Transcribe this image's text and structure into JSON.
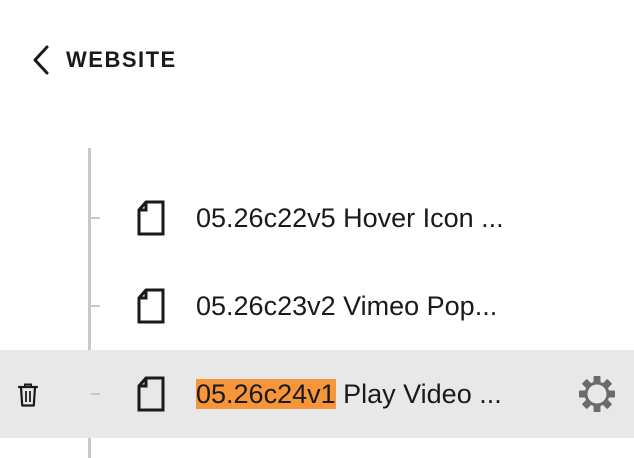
{
  "header": {
    "back_label": "WEBSITE"
  },
  "pages": [
    {
      "label": "05.26c22v5 Hover Icon ..."
    },
    {
      "label": "05.26c23v2 Vimeo Pop..."
    },
    {
      "label_highlight": "05.26c24v1",
      "label_rest": " Play Video ...",
      "selected": true
    }
  ],
  "colors": {
    "highlight": "#f7953a",
    "selected_row": "#e8e8e8",
    "tree_line": "#c8c8c8"
  },
  "icons": {
    "back": "chevron-left-icon",
    "page": "page-icon",
    "delete": "trash-icon",
    "settings": "gear-icon"
  }
}
